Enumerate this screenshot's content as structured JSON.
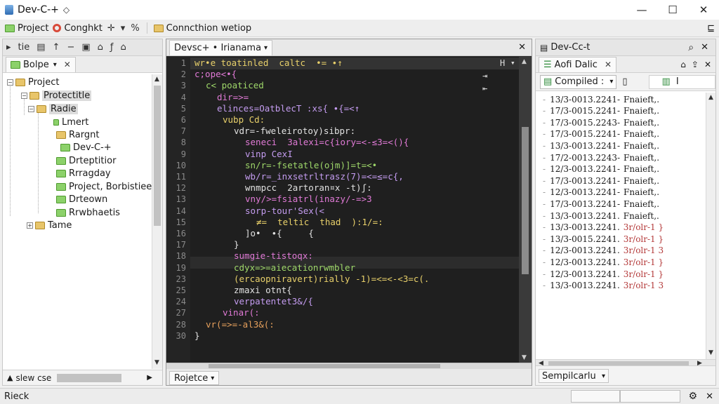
{
  "window": {
    "title": "Dev-C-+",
    "title_symbol": "◇",
    "minimize": "—",
    "maximize": "☐",
    "close": "✕"
  },
  "toolbar": {
    "project_label": "Project",
    "compile_label": "Conghkt",
    "sym_pin": "✛",
    "sym_arrow": "▾",
    "sym_percent": "%",
    "connection_label": "Conncthion wetiop",
    "right_icon": "⊑"
  },
  "left_panel": {
    "tab_label": "Bolpe",
    "tab_close": "✕",
    "header_tools": [
      "tie",
      "▸",
      "▤",
      "↑",
      "−",
      "▣",
      "⌂",
      "ƒ",
      "⌂"
    ],
    "tree": [
      {
        "label": "Project",
        "icon": "folder-icon"
      },
      {
        "label": "Protectitle",
        "icon": "folder-icon"
      },
      {
        "label": "Radie",
        "icon": "folder-icon"
      },
      {
        "label": "Lmert",
        "icon": "file-icon"
      },
      {
        "label": "Rargnt",
        "icon": "folder-icon"
      },
      {
        "label": "Dev-C-+",
        "icon": "folder-icon"
      },
      {
        "label": "Drteptitior",
        "icon": "file-icon"
      },
      {
        "label": "Rrragday",
        "icon": "file-icon"
      },
      {
        "label": "Project, Borbistiee",
        "icon": "file-icon"
      },
      {
        "label": "Drteown",
        "icon": "file-icon"
      },
      {
        "label": "Rrwbhaetis",
        "icon": "file-icon"
      },
      {
        "label": "Tame",
        "icon": "folder-icon"
      }
    ],
    "bottom_label": "slew cse"
  },
  "editor": {
    "tab_label": "Devsc+ • Irianama",
    "tab_close": "✕",
    "close_icon": "✕",
    "gutter_tools": [
      "Η",
      "▾"
    ],
    "line_numbers": [
      "1",
      "2",
      "3",
      "4",
      "5",
      "6",
      "7",
      "8",
      "9",
      "10",
      "11",
      "12",
      "13",
      "14",
      "15",
      "16",
      "17",
      "18",
      "19",
      "23",
      "25",
      "24",
      "27",
      "28",
      "30"
    ],
    "lines": [
      "wr•e toatinled  caltc  •= ∙↑",
      "c;ope<•{",
      "c< poaticed",
      "dir=>=",
      "elinces=OatblecT :xs{ ∙{=<↑",
      "vubp Cd:",
      "vdr=-fweleirotoy)sibpr:",
      "seneci  3alexi=c{iory=<-≤3=<(){",
      "vinp CexI",
      "sn/r=-fsetatle(ojm)]=t=<•",
      "wb/r=_inxsetrltrasz(7)=<=≤=c{,",
      "wnmpcc  2artoran¤x -t)ʃ:",
      "vny/>=fsiatrl(inazy/-=>3",
      "sorp-tour'Sex(<",
      "≠=  teltic  thad  ):1/=:",
      "]o•  ∙{     {",
      "}",
      "sumgie-tistoqx:",
      "cdyx=>=aiecationrwmbler",
      "(ercaopniravert)rially -1)=<=<-<3=c(.",
      "zmaxi otnt{",
      "verpatentet3&/{",
      "vinar(:",
      "vr(=>=-al3&(:",
      "}"
    ],
    "bottom_tab": "Rojetce",
    "bottom_tab_arrow": "▾"
  },
  "right_panel": {
    "tab_label": "Dev-Cc-t",
    "search_icon": "⌕",
    "close_icon": "✕",
    "subtab_label": "Aofi Dalic",
    "subtab_close": "✕",
    "subtab_tools": [
      "⌂",
      "⇪",
      "✕"
    ],
    "compile_combo": "Compiled :",
    "compile_combo_arrow": "▾",
    "compile_extra": "▯",
    "compile_right": "I",
    "log": [
      {
        "ts": "13/3-0013.2241-",
        "msg": "Fnaieft,.",
        "type": "normal"
      },
      {
        "ts": "17/3-0015.2241-",
        "msg": "Fnaieft,.",
        "type": "normal"
      },
      {
        "ts": "17/3-0015.2243-",
        "msg": "Fnaieft,.",
        "type": "normal"
      },
      {
        "ts": "17/3-0015.2241-",
        "msg": "Fnaieft,.",
        "type": "normal"
      },
      {
        "ts": "13/3-0013.2241-",
        "msg": "Fnaieft,.",
        "type": "normal"
      },
      {
        "ts": "17/2-0013.2243-",
        "msg": "Fnaieft,.",
        "type": "normal"
      },
      {
        "ts": "12/3-0013.2241-",
        "msg": "Fnaieft,.",
        "type": "normal"
      },
      {
        "ts": "17/3-0013.2241-",
        "msg": "Fnaieft,.",
        "type": "normal"
      },
      {
        "ts": "12/3-0013.2241-",
        "msg": "Fnaieft,.",
        "type": "normal"
      },
      {
        "ts": "17/3-0013.2241-",
        "msg": "Fnaieft,.",
        "type": "normal"
      },
      {
        "ts": "13/3-0013.2241.",
        "msg": "Fnaieft,.",
        "type": "normal"
      },
      {
        "ts": "13/3-0013.2241.",
        "msg": "3r/olr-1 }",
        "type": "error"
      },
      {
        "ts": "13/3-0015.2241.",
        "msg": "3r/olr-1 }",
        "type": "error"
      },
      {
        "ts": "12/3-0013.2241.",
        "msg": "3r/olr-1 3",
        "type": "error"
      },
      {
        "ts": "12/3-0013.2241.",
        "msg": "3r/olr-1 }",
        "type": "error"
      },
      {
        "ts": "12/3-0013.2241.",
        "msg": "3r/olr-1 }",
        "type": "error"
      },
      {
        "ts": "13/3-0013.2241.",
        "msg": "3r/olr-1 3",
        "type": "error"
      }
    ],
    "bottom_combo": "Sempilcarlu",
    "bottom_combo_arrow": "▾"
  },
  "statusbar": {
    "label": "Rieck",
    "settings_icon": "⚙",
    "close_icon": "✕"
  }
}
